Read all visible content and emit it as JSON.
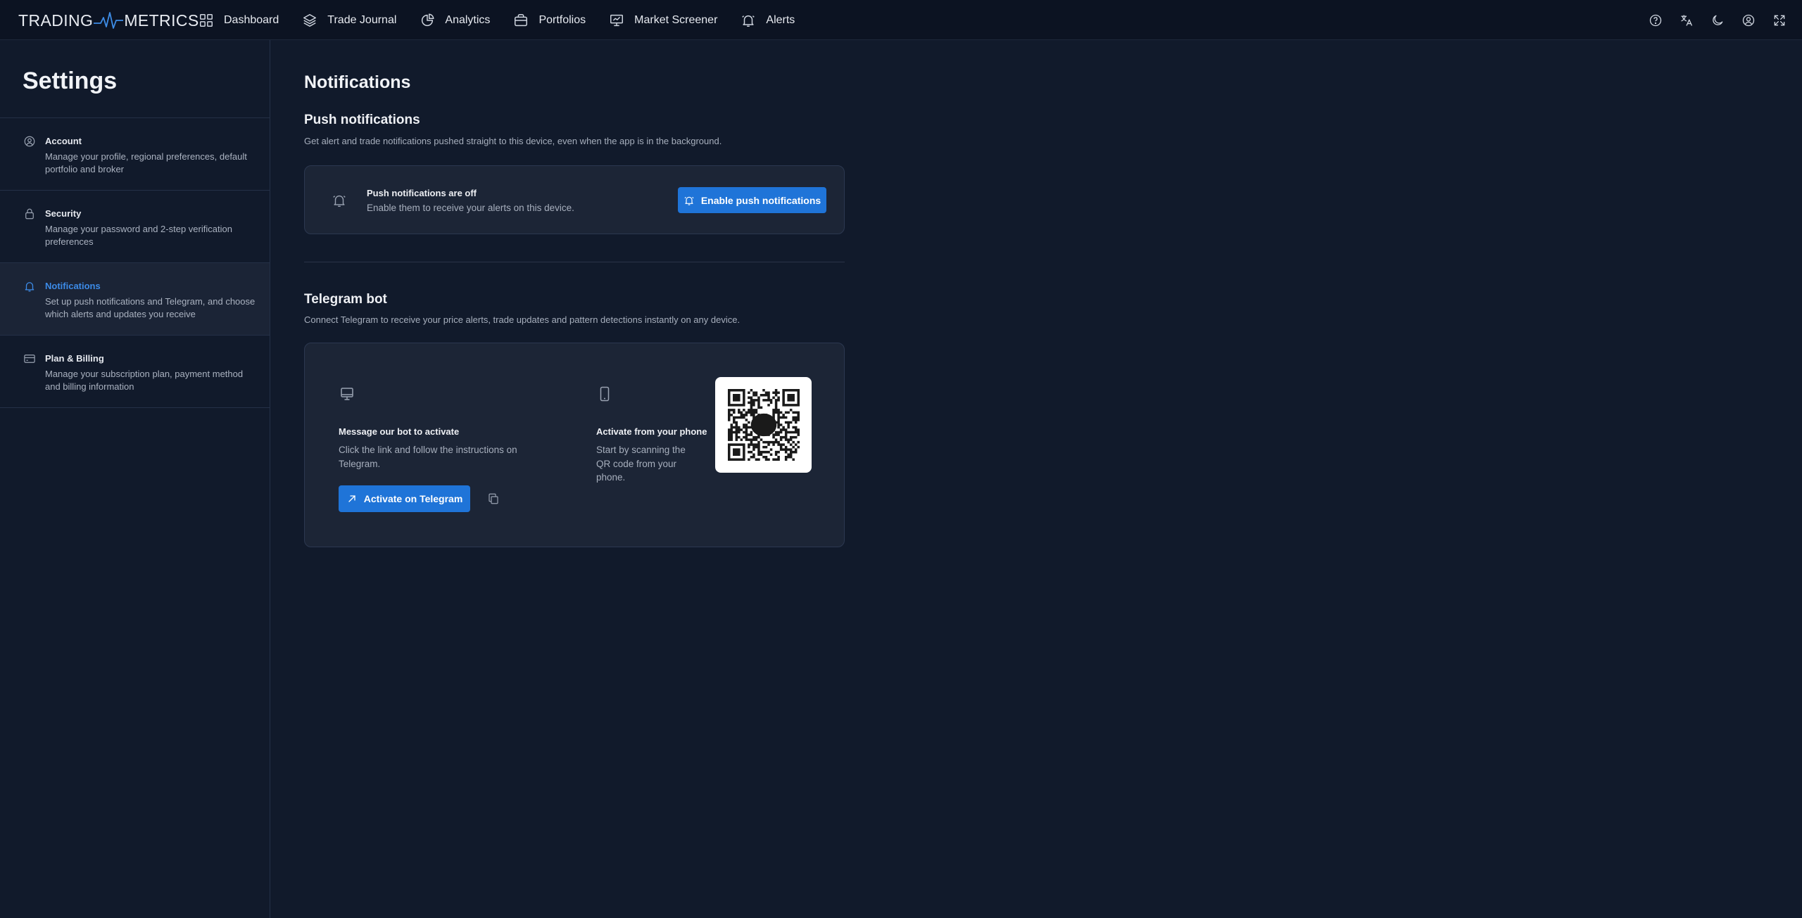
{
  "brand": {
    "left": "TRADING",
    "right": "METRICS"
  },
  "nav": {
    "items": [
      {
        "label": "Dashboard",
        "icon": "grid-icon"
      },
      {
        "label": "Trade Journal",
        "icon": "layers-icon"
      },
      {
        "label": "Analytics",
        "icon": "pie-chart-icon"
      },
      {
        "label": "Portfolios",
        "icon": "briefcase-icon"
      },
      {
        "label": "Market Screener",
        "icon": "presentation-chart-icon"
      },
      {
        "label": "Alerts",
        "icon": "bell-icon"
      }
    ],
    "right_icons": [
      "help-icon",
      "translate-icon",
      "moon-icon",
      "user-icon",
      "fullscreen-icon"
    ]
  },
  "sidebar": {
    "title": "Settings",
    "items": [
      {
        "title": "Account",
        "desc": "Manage your profile, regional preferences, default portfolio and broker",
        "icon": "user-circle-icon",
        "active": false
      },
      {
        "title": "Security",
        "desc": "Manage your password and 2-step verification preferences",
        "icon": "lock-icon",
        "active": false
      },
      {
        "title": "Notifications",
        "desc": "Set up push notifications and Telegram, and choose which alerts and updates you receive",
        "icon": "bell-icon",
        "active": true
      },
      {
        "title": "Plan & Billing",
        "desc": "Manage your subscription plan, payment method and billing information",
        "icon": "credit-card-icon",
        "active": false
      }
    ]
  },
  "main": {
    "title": "Notifications",
    "push": {
      "heading": "Push notifications",
      "desc": "Get alert and trade notifications pushed straight to this device, even when the app is in the background.",
      "status_title": "Push notifications are off",
      "status_desc": "Enable them to receive your alerts on this device.",
      "button": "Enable push notifications"
    },
    "telegram": {
      "heading": "Telegram bot",
      "desc": "Connect Telegram to receive your price alerts, trade updates and pattern detections instantly on any device.",
      "bot_title": "Message our bot to activate",
      "bot_desc": "Click the link and follow the instructions on Telegram.",
      "bot_button": "Activate on Telegram",
      "phone_title": "Activate from your phone",
      "phone_desc": "Start by scanning the QR code from your phone."
    }
  },
  "colors": {
    "background": "#111a2b",
    "topbar": "#0c1322",
    "card": "#1c2536",
    "accent": "#1f74d8",
    "active_text": "#3c8be8"
  }
}
